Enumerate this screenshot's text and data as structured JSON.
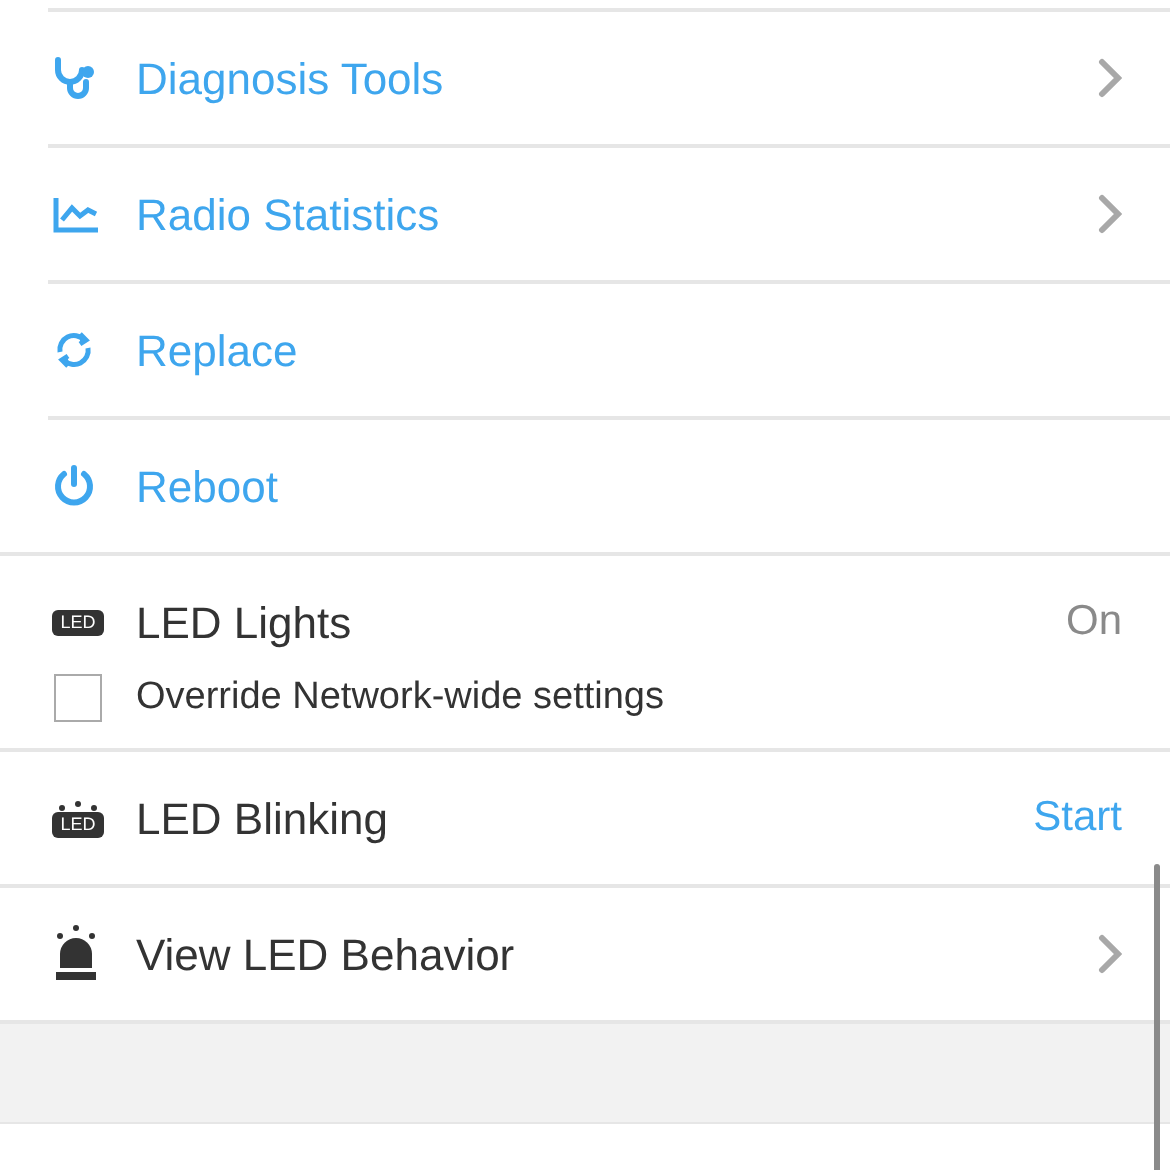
{
  "items": [
    {
      "kind": "action",
      "label": "Diagnosis Tools",
      "chevron": true
    },
    {
      "kind": "action",
      "label": "Radio Statistics",
      "chevron": true
    },
    {
      "kind": "action",
      "label": "Replace",
      "chevron": false
    },
    {
      "kind": "action",
      "label": "Reboot",
      "chevron": false
    },
    {
      "kind": "setting",
      "badge": "LED",
      "label": "LED Lights",
      "value": "On",
      "option": {
        "label": "Override Network-wide settings",
        "checked": false
      }
    },
    {
      "kind": "setting",
      "badge": "LED",
      "label": "LED Blinking",
      "action_label": "Start"
    },
    {
      "kind": "setting",
      "label": "View LED Behavior",
      "chevron": true
    }
  ]
}
